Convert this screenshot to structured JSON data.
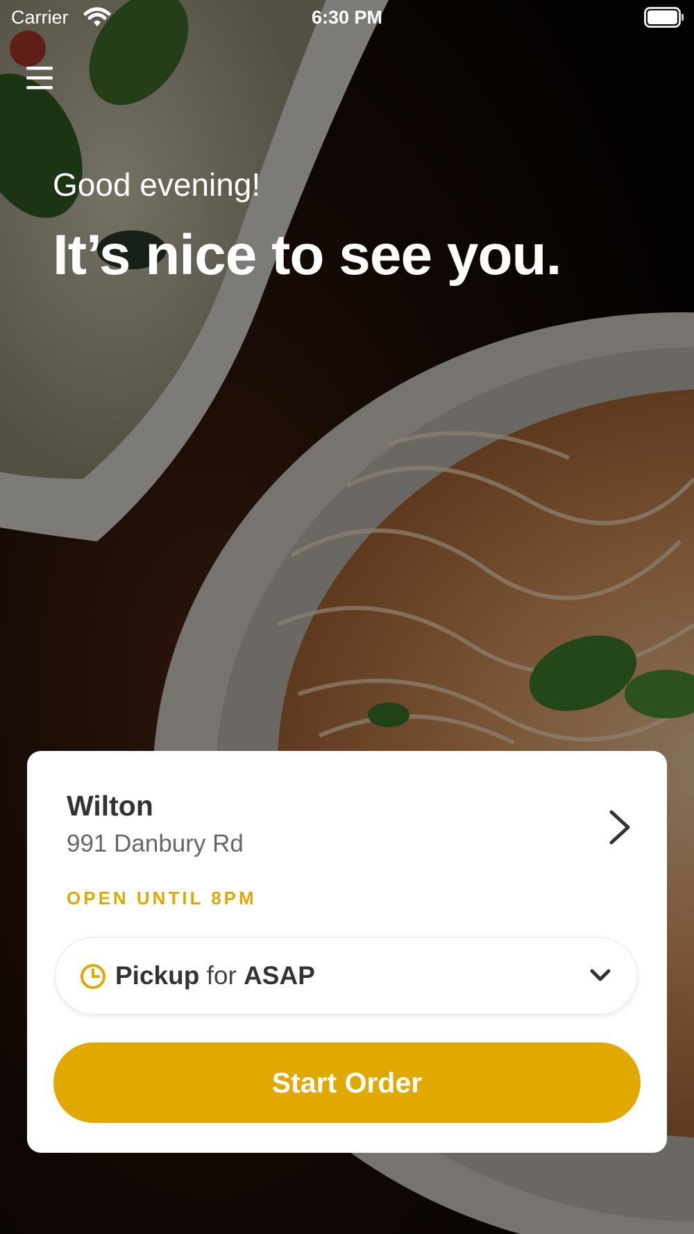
{
  "status_bar": {
    "carrier": "Carrier",
    "time": "6:30 PM",
    "wifi_icon": "wifi-icon",
    "battery_icon": "battery-full-icon"
  },
  "menu": {
    "icon": "hamburger-menu-icon"
  },
  "greeting": {
    "salutation": "Good evening!",
    "headline": "It’s nice to see you."
  },
  "store": {
    "name": "Wilton",
    "address": "991 Danbury Rd",
    "hours": "OPEN UNTIL 8PM",
    "chevron_icon": "chevron-right-icon"
  },
  "order_mode": {
    "icon": "clock-icon",
    "mode": "Pickup",
    "connector": "for",
    "time": "ASAP",
    "dropdown_icon": "chevron-down-icon"
  },
  "cta": {
    "label": "Start Order"
  },
  "colors": {
    "accent": "#E1A800",
    "card_background": "#FFFFFF",
    "primary_text": "#333333",
    "secondary_text": "#666666"
  }
}
